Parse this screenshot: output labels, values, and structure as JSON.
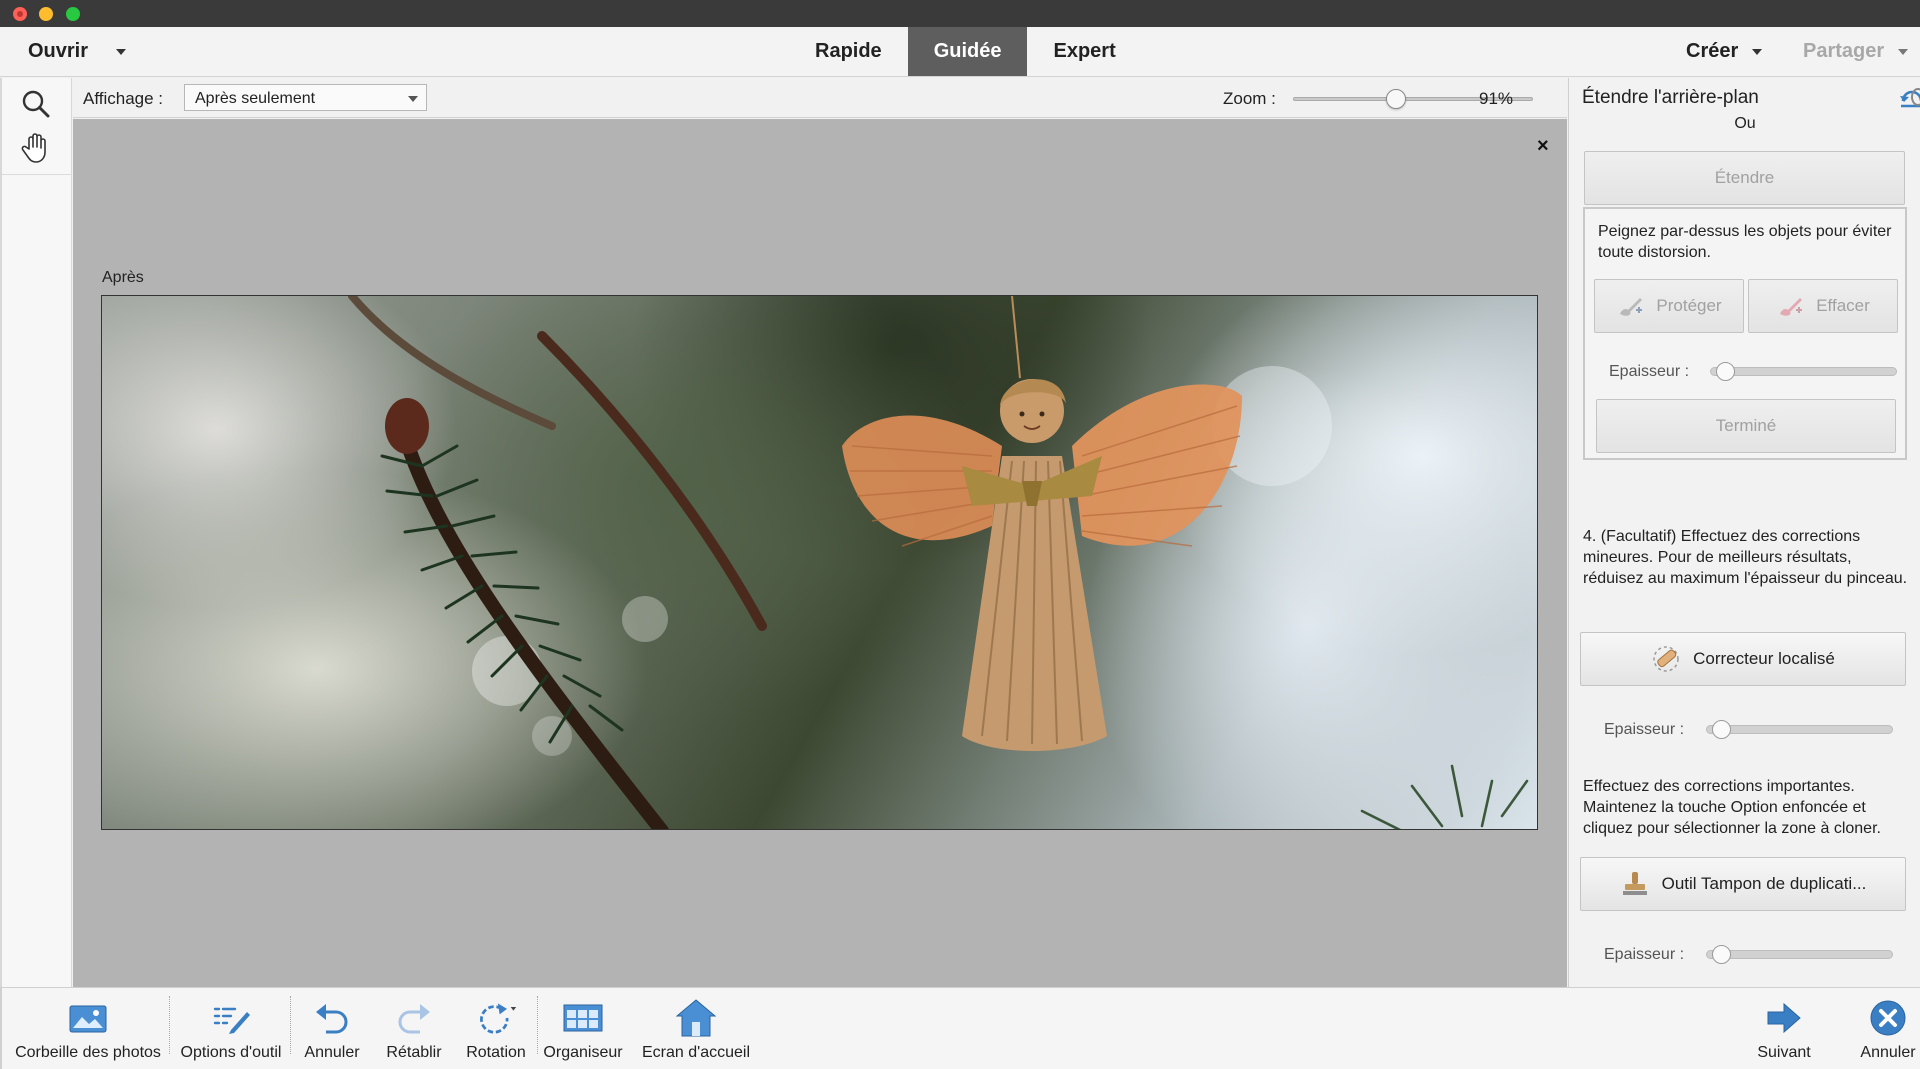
{
  "menubar": {
    "open_label": "Ouvrir",
    "tabs": [
      {
        "label": "Rapide",
        "active": false
      },
      {
        "label": "Guidée",
        "active": true
      },
      {
        "label": "Expert",
        "active": false
      }
    ],
    "create_label": "Créer",
    "share_label": "Partager"
  },
  "tools": [
    {
      "name": "zoom-tool",
      "icon": "magnifier-icon"
    },
    {
      "name": "hand-tool",
      "icon": "hand-icon"
    }
  ],
  "view_options": {
    "display_label": "Affichage :",
    "display_value": "Après seulement",
    "zoom_label": "Zoom :",
    "zoom_value": "91%",
    "zoom_percent": 91
  },
  "canvas": {
    "close_symbol": "×",
    "after_label": "Après"
  },
  "panel": {
    "title": "Étendre l'arrière-plan",
    "or_label": "Ou",
    "extend_button": "Étendre",
    "paint_hint": "Peignez par-dessus les objets pour éviter toute distorsion.",
    "protect_button": "Protéger",
    "erase_button": "Effacer",
    "thickness_label": "Epaisseur :",
    "done_button": "Terminé",
    "step4_text": "4. (Facultatif) Effectuez des corrections mineures. Pour de meilleurs résultats, réduisez au maximum l'épaisseur du pinceau.",
    "spot_healing_button": "Correcteur localisé",
    "major_text": "Effectuez des corrections importantes. Maintenez la touche Option enfoncée et cliquez pour sélectionner la zone à cloner.",
    "clone_stamp_button": "Outil Tampon de duplicati..."
  },
  "bottombar": {
    "photo_bin": "Corbeille des photos",
    "tool_options": "Options d'outil",
    "undo": "Annuler",
    "redo": "Rétablir",
    "rotate": "Rotation",
    "organizer": "Organiseur",
    "home_screen": "Ecran d'accueil",
    "next": "Suivant",
    "cancel": "Annuler"
  },
  "colors": {
    "active_tab": "#5e5e5e",
    "accent_blue": "#3a7fc4",
    "canvas_bg": "#b3b3b3"
  }
}
